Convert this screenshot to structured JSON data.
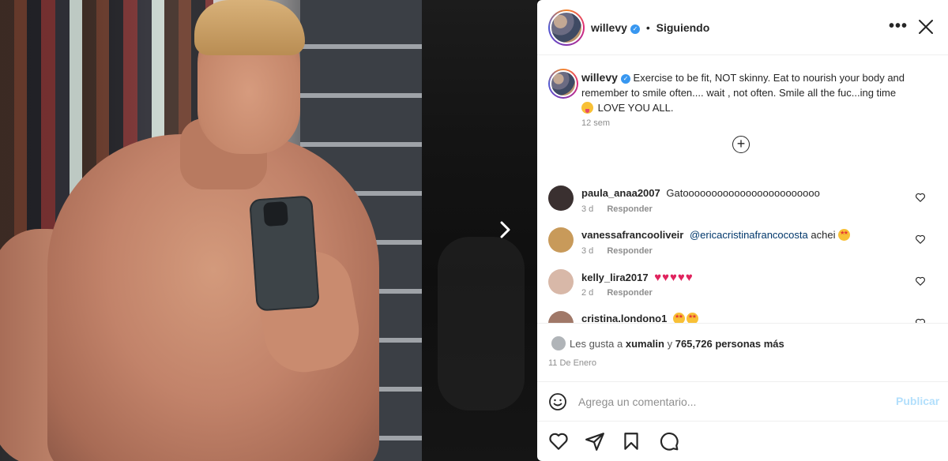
{
  "post": {
    "username": "willevy",
    "verified": true,
    "follow_status": "Siguiendo",
    "caption": "Exercise to be fit, NOT skinny. Eat to nourish your body and remember to smile often.... wait , not often. Smile all the fuc...ing time",
    "caption_tail": "LOVE YOU ALL.",
    "caption_time": "12 sem",
    "likes_prefix": "Les gusta a",
    "likes_user": "xumalin",
    "likes_conj": "y",
    "likes_count": "765,726 personas más",
    "date": "11 De Enero"
  },
  "comments": [
    {
      "username": "paula_anaa2007",
      "text": "Gatoooooooooooooooooooooooo",
      "time": "3 d",
      "reply": "Responder",
      "avatar_color": "#3a3030"
    },
    {
      "username": "vanessafrancooliveir",
      "mention": "@ericacristinafrancocosta",
      "text": "achei",
      "time": "3 d",
      "reply": "Responder",
      "avatar_color": "#c89a5a"
    },
    {
      "username": "kelly_lira2017",
      "text": "",
      "time": "2 d",
      "reply": "Responder",
      "avatar_color": "#d8b8a8"
    },
    {
      "username": "cristina.londono1",
      "text": "",
      "time": "",
      "reply": "",
      "avatar_color": "#a07868"
    }
  ],
  "composer": {
    "placeholder": "Agrega un comentario...",
    "submit_label": "Publicar"
  },
  "icons": {
    "more": "more-options-icon",
    "close": "close-icon",
    "load_more": "plus-circle-icon",
    "like": "heart-icon",
    "share": "paper-plane-icon",
    "save": "bookmark-icon",
    "comment": "comment-bubble-icon",
    "emoji": "smiley-icon",
    "next": "chevron-right-icon"
  },
  "colors": {
    "verified": "#3897f0",
    "publish_disabled": "#b2dffc",
    "link": "#00376b"
  }
}
